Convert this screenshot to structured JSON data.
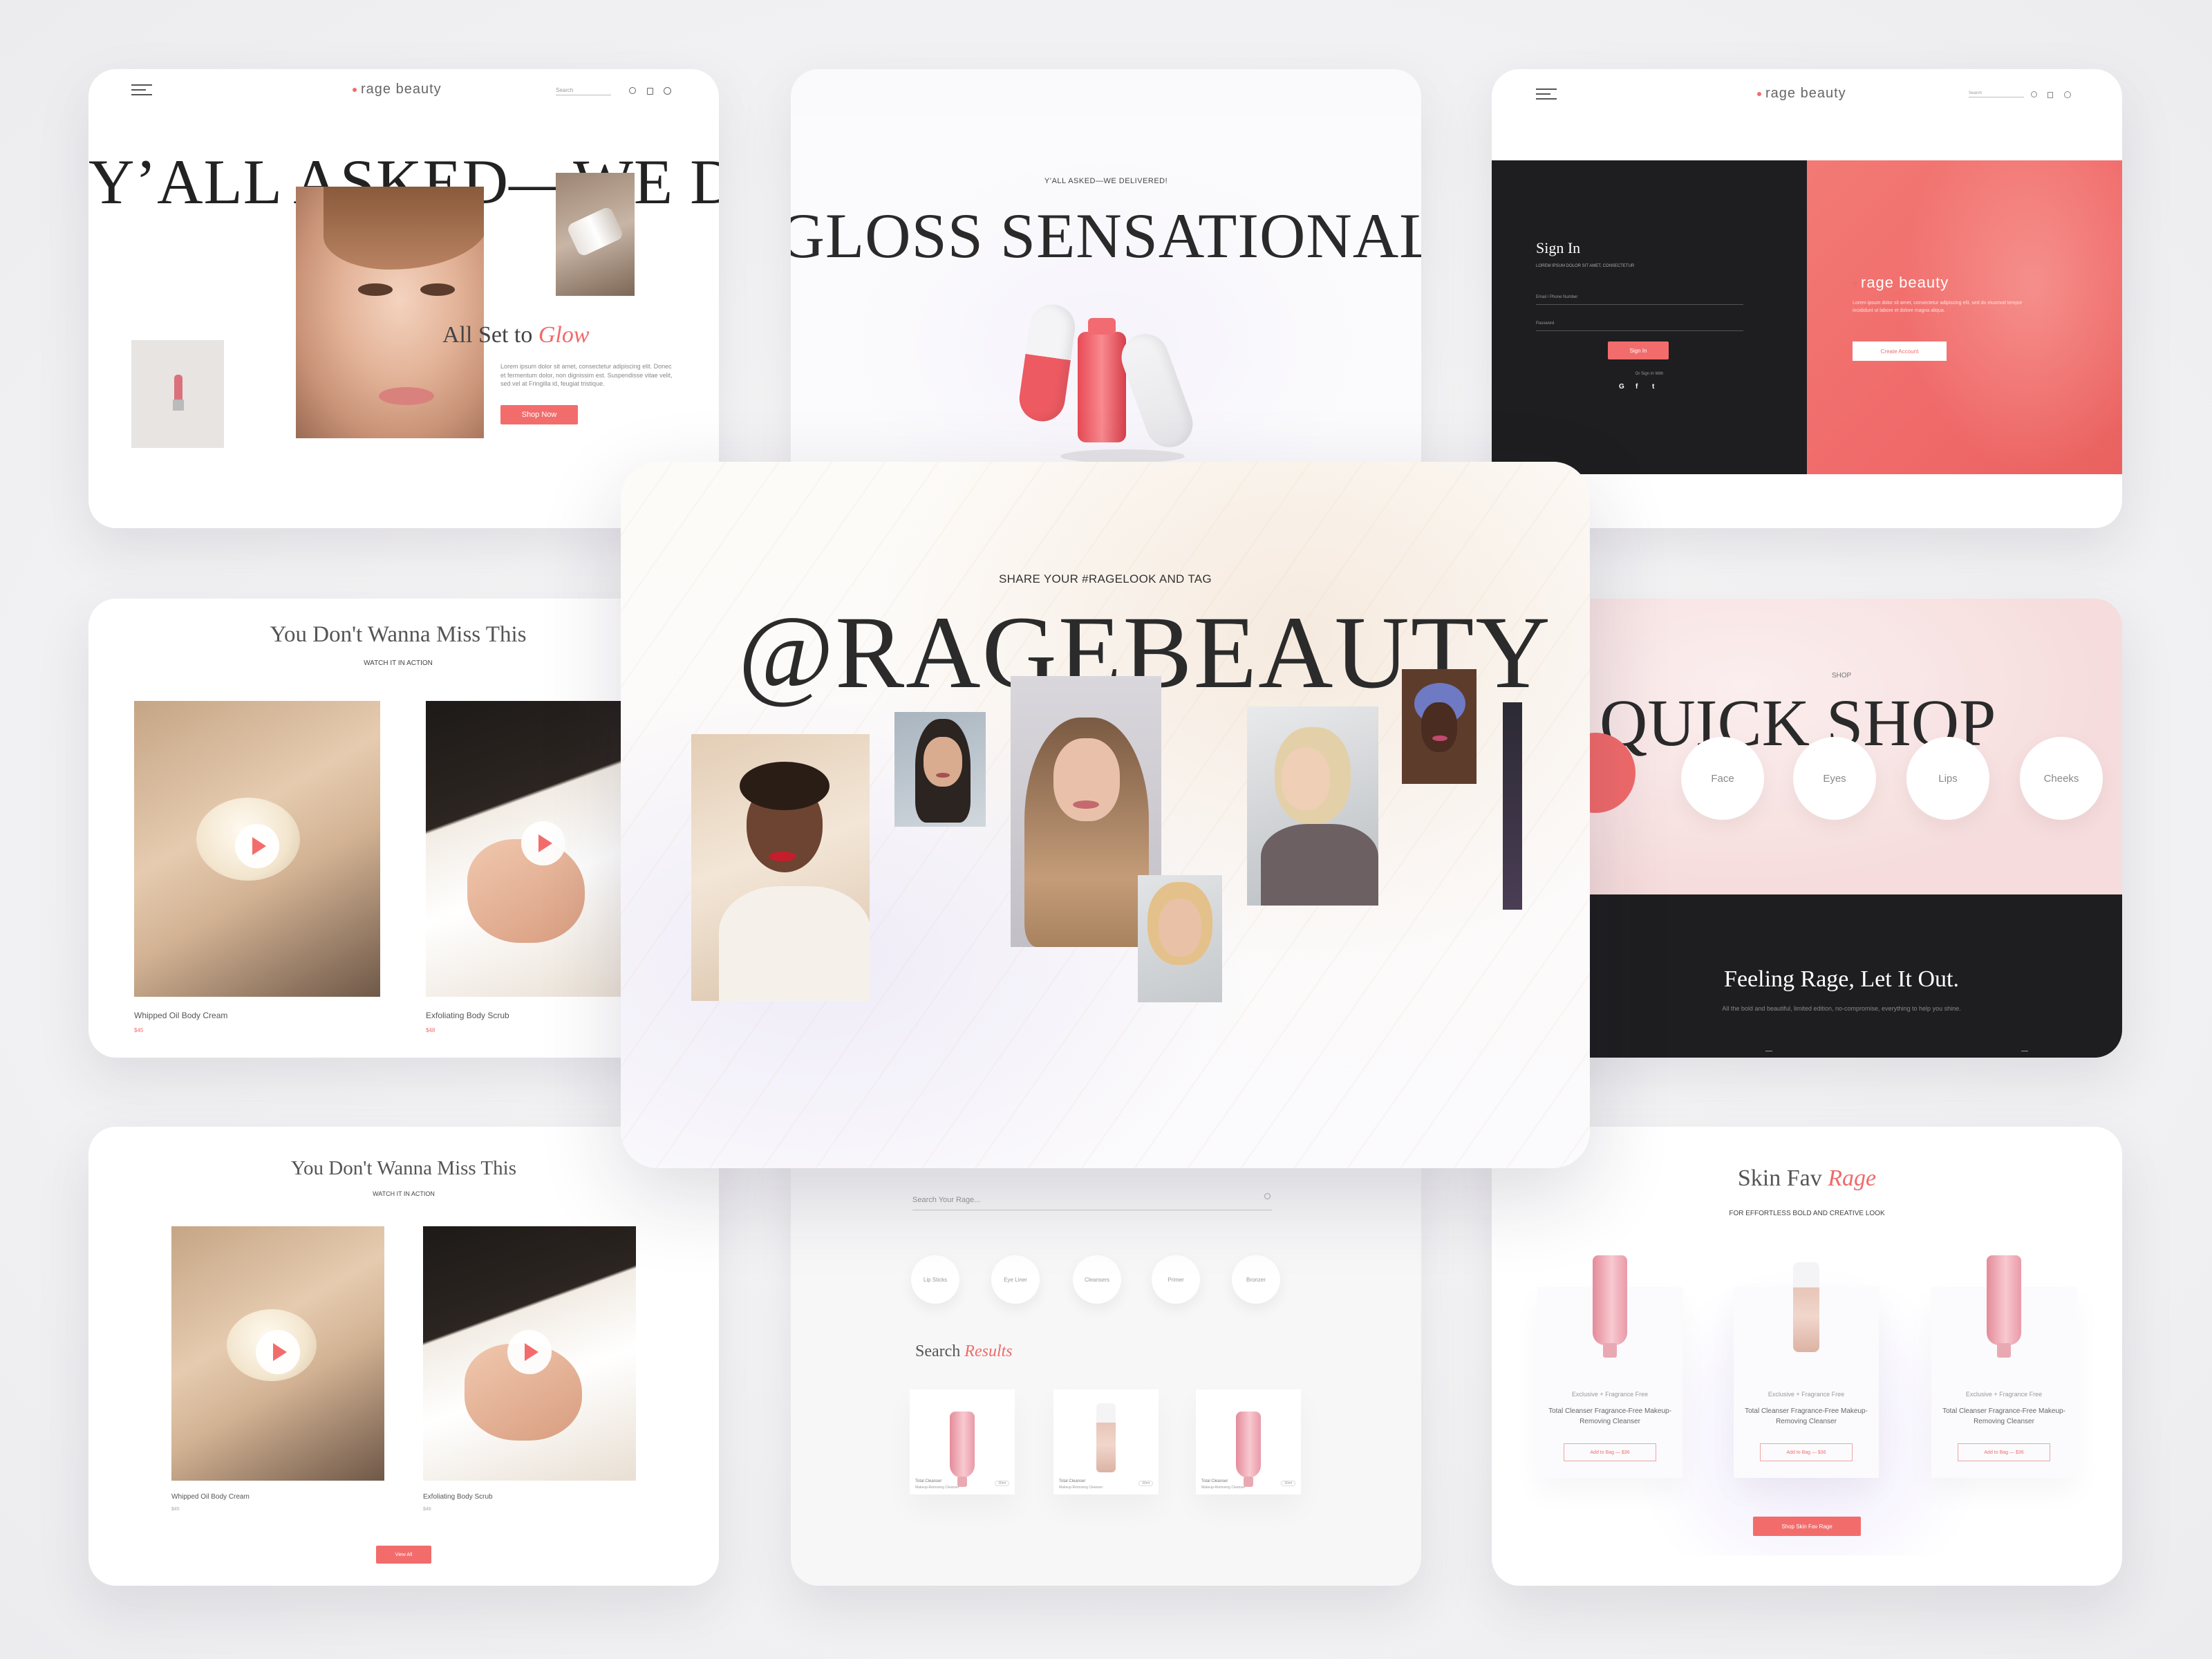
{
  "brand": {
    "name": "rage beauty",
    "accent": "#f36c6c",
    "dark": "#1d1d1f"
  },
  "card_hero": {
    "search_placeholder": "Search",
    "headline": "Y’ALL ASKED—WE DE",
    "title_plain": "All Set to",
    "title_accent": "Glow",
    "body": "Lorem ipsum dolor sit amet, consectetur adipiscing elit. Donec et fermentum dolor, non dignissim est. Suspendisse vitae velit, sed vel at Fringilla id, feugiat tristique.",
    "cta": "Shop Now"
  },
  "card_gloss": {
    "kicker": "Y’ALL ASKED—WE DELIVERED!",
    "headline": "GLOSS SENSATIONAL"
  },
  "card_signin": {
    "search_placeholder": "Search",
    "title": "Sign In",
    "subtitle": "LOREM IPSUM DOLOR SIT AMET, CONSECTETUR",
    "email_label": "Email / Phone Number",
    "password_label": "Password",
    "submit": "Sign In",
    "or_label": "Or Sign In With",
    "social": [
      "G",
      "f",
      "t"
    ],
    "promo_text": "Lorem ipsum dolor sit amet, consectetur adipiscing elit, sed do eiusmod tempor incididunt ut labore et dolore magna aliqua.",
    "create_account": "Create Account"
  },
  "card_videos_top": {
    "title": "You Don't Wanna Miss This",
    "kicker": "WATCH IT IN ACTION",
    "items": [
      {
        "name": "Whipped Oil Body Cream",
        "price": "$45"
      },
      {
        "name": "Exfoliating Body Scrub",
        "price": "$48"
      }
    ]
  },
  "card_center": {
    "kicker": "SHARE YOUR #RAGELOOK AND TAG",
    "headline": "@RAGEBEAUTY"
  },
  "card_quickshop": {
    "kicker": "SHOP",
    "headline": "QUICK SHOP",
    "categories": [
      "Face",
      "Eyes",
      "Lips",
      "Cheeks"
    ],
    "banner_title": "Feeling Rage, Let It Out.",
    "banner_text": "All the bold and beautiful, limited edition, no-compromise, everything to help you shine."
  },
  "card_videos_bottom": {
    "title": "You Don't Wanna Miss This",
    "kicker": "WATCH IT IN ACTION",
    "items": [
      {
        "name": "Whipped Oil Body Cream",
        "price": "$45"
      },
      {
        "name": "Exfoliating Body Scrub",
        "price": "$48"
      }
    ],
    "cta": "View All"
  },
  "card_search": {
    "placeholder": "Search Your Rage...",
    "chips": [
      "Lip Sticks",
      "Eye Liner",
      "Cleansers",
      "Primer",
      "Bronzer"
    ],
    "results_plain": "Search",
    "results_accent": "Results",
    "products": [
      {
        "name": "Total Cleanser",
        "sub": "Makeup-Removing Cleanser",
        "qty": "30ml"
      },
      {
        "name": "Total Cleanser",
        "sub": "Makeup-Removing Cleanser",
        "qty": "30ml"
      },
      {
        "name": "Total Cleanser",
        "sub": "Makeup-Removing Cleanser",
        "qty": "30ml"
      }
    ]
  },
  "card_skinfav": {
    "title_plain": "Skin Fav",
    "title_accent": "Rage",
    "kicker": "FOR EFFORTLESS BOLD AND CREATIVE LOOK",
    "products": [
      {
        "tag": "Exclusive + Fragrance Free",
        "name": "Total Cleanser Fragrance-Free Makeup-Removing Cleanser",
        "cta": "Add to Bag — $36"
      },
      {
        "tag": "Exclusive + Fragrance Free",
        "name": "Total Cleanser Fragrance-Free Makeup-Removing Cleanser",
        "cta": "Add to Bag — $36"
      },
      {
        "tag": "Exclusive + Fragrance Free",
        "name": "Total Cleanser Fragrance-Free Makeup-Removing Cleanser",
        "cta": "Add to Bag — $36"
      }
    ],
    "cta": "Shop Skin Fav Rage"
  }
}
